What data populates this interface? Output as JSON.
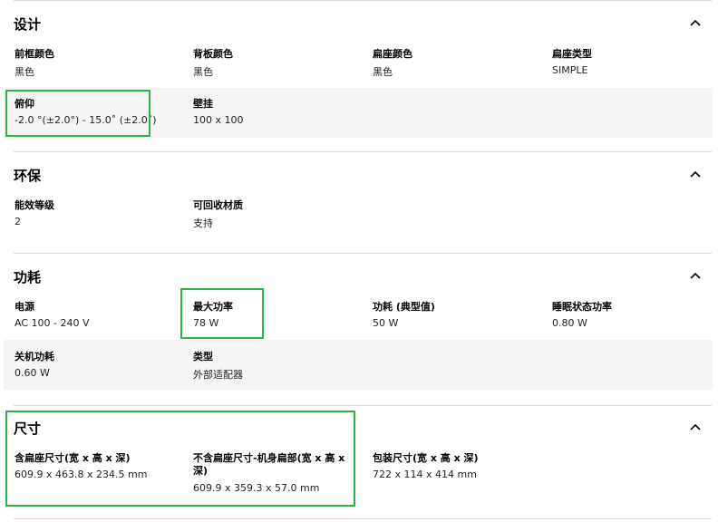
{
  "sections": {
    "design": {
      "title": "设计",
      "front_color": {
        "label": "前框颜色",
        "value": "黑色"
      },
      "back_color": {
        "label": "背板颜色",
        "value": "黑色"
      },
      "stand_color": {
        "label": "扁座颜色",
        "value": "黑色"
      },
      "stand_type": {
        "label": "扁座类型",
        "value": "SIMPLE"
      },
      "tilt": {
        "label": "俯仰",
        "value": "-2.0 °(±2.0°) - 15.0˚ (±2.0˚)"
      },
      "wall_mount": {
        "label": "壁挂",
        "value": "100 x 100"
      }
    },
    "eco": {
      "title": "环保",
      "energy_class": {
        "label": "能效等级",
        "value": "2"
      },
      "recyclable": {
        "label": "可回收材质",
        "value": "支持"
      }
    },
    "power": {
      "title": "功耗",
      "supply": {
        "label": "电源",
        "value": "AC 100 - 240 V"
      },
      "max_power": {
        "label": "最大功率",
        "value": "78 W"
      },
      "typical": {
        "label": "功耗 (典型值)",
        "value": "50 W"
      },
      "sleep": {
        "label": "睡眠状态功率",
        "value": "0.80 W"
      },
      "off": {
        "label": "关机功耗",
        "value": "0.60 W"
      },
      "type": {
        "label": "类型",
        "value": "外部适配器"
      }
    },
    "dimensions": {
      "title": "尺寸",
      "with_stand": {
        "label": "含扁座尺寸(宽 x 高 x 深)",
        "value": "609.9 x 463.8 x 234.5 mm"
      },
      "without_stand_line1": "不含扁座尺寸-机身扁部(宽 x 高 x",
      "without_stand_line2": "深)",
      "without_stand_value": "609.9 x 359.3 x 57.0 mm",
      "package": {
        "label": "包装尺寸(宽 x 高 x 深)",
        "value": "722 x 114 x 414 mm"
      }
    }
  },
  "icons": {
    "collapse": "chevron-up-icon"
  },
  "colors": {
    "highlight": "#2db34a",
    "band": "#f5f5f5",
    "divider": "#dcdcdc"
  }
}
